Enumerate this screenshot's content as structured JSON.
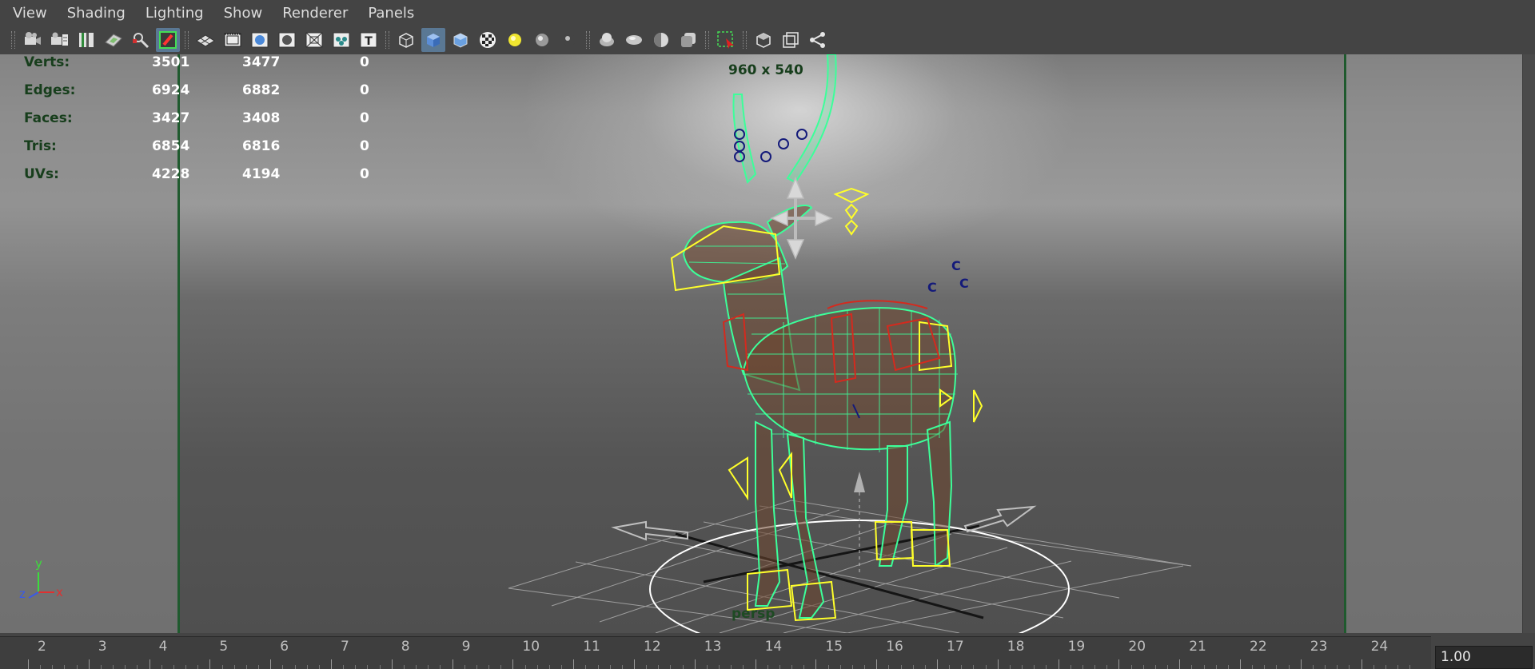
{
  "menu": {
    "items": [
      "View",
      "Shading",
      "Lighting",
      "Show",
      "Renderer",
      "Panels"
    ]
  },
  "toolbar": {
    "groups": [
      [
        "camera-icon",
        "camera-attributes-icon",
        "bookmarks-icon",
        "image-plane-icon",
        "pan-zoom-icon",
        "grease-pencil-icon"
      ],
      [
        "grid-icon",
        "film-gate-icon",
        "resolution-gate-icon",
        "gate-mask-icon",
        "field-chart-icon",
        "safe-action-icon",
        "safe-title-icon"
      ],
      [
        "wireframe-icon",
        "smooth-shade-icon",
        "flat-shade-icon",
        "textured-icon",
        "use-all-lights-icon",
        "shadows-icon",
        "screen-space-ao-icon"
      ],
      [
        "motion-blur-icon",
        "anti-aliasing-icon",
        "depth-of-field-icon",
        "xray-icon"
      ],
      [
        "isolate-select-icon"
      ],
      [
        "xray-joints-icon",
        "xray-active-icon",
        "node-editor-icon"
      ]
    ]
  },
  "hud": {
    "rows": [
      {
        "label": "Verts:",
        "v1": "3501",
        "v2": "3477",
        "v3": "0"
      },
      {
        "label": "Edges:",
        "v1": "6924",
        "v2": "6882",
        "v3": "0"
      },
      {
        "label": "Faces:",
        "v1": "3427",
        "v2": "3408",
        "v3": "0"
      },
      {
        "label": "Tris:",
        "v1": "6854",
        "v2": "6816",
        "v3": "0"
      },
      {
        "label": "UVs:",
        "v1": "4228",
        "v2": "4194",
        "v3": "0"
      }
    ]
  },
  "viewport": {
    "resolution": "960 x 540",
    "camera": "persp",
    "axes": {
      "x": "x",
      "y": "y",
      "z": "z"
    }
  },
  "timeline": {
    "ticks": [
      "2",
      "3",
      "4",
      "5",
      "6",
      "7",
      "8",
      "9",
      "10",
      "11",
      "12",
      "13",
      "14",
      "15",
      "16",
      "17",
      "18",
      "19",
      "20",
      "21",
      "22",
      "23",
      "24"
    ],
    "current_frame": "1.00"
  },
  "colors": {
    "wireframe": "#3cff9a",
    "controls": "#ffff2a",
    "controls_red": "#d42a1e",
    "controls_blue": "#141a7a",
    "gate_line": "#1f5a2e"
  }
}
